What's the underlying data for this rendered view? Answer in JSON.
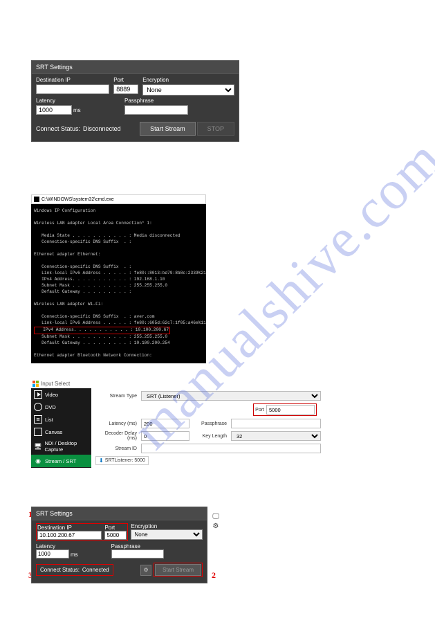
{
  "panel1": {
    "title": "SRT Settings",
    "dest_ip_label": "Destination IP",
    "dest_ip_value": "",
    "port_label": "Port",
    "port_value": "8889",
    "encryption_label": "Encryption",
    "encryption_value": "None",
    "latency_label": "Latency",
    "latency_value": "1000",
    "latency_unit": "ms",
    "passphrase_label": "Passphrase",
    "passphrase_value": "",
    "status_label": "Connect Status:",
    "status_value": "Disconnected",
    "start_btn": "Start Stream",
    "stop_btn": "STOP"
  },
  "panel2": {
    "title": "C:\\WINDOWS\\system32\\cmd.exe",
    "lines": [
      "Windows IP Configuration",
      "",
      "Wireless LAN adapter Local Area Connection* 1:",
      "",
      "   Media State . . . . . . . . . . . : Media disconnected",
      "   Connection-specific DNS Suffix  . :",
      "",
      "Ethernet adapter Ethernet:",
      "",
      "   Connection-specific DNS Suffix  . :",
      "   Link-local IPv6 Address . . . . . : fe80::8013:bd79:8b8c:2339%21",
      "   IPv4 Address. . . . . . . . . . . : 192.168.1.10",
      "   Subnet Mask . . . . . . . . . . . : 255.255.255.0",
      "   Default Gateway . . . . . . . . . :",
      "",
      "Wireless LAN adapter Wi-Fi:",
      "",
      "   Connection-specific DNS Suffix  . : aver.com",
      "   Link-local IPv6 Address . . . . . : fe80::605d:62c7:1f05:a46e%11"
    ],
    "highlight_line": "   IPv4 Address. . . . . . . . . . . : 10.100.200.67",
    "lines_after": [
      "   Subnet Mask . . . . . . . . . . . : 255.255.255.0",
      "   Default Gateway . . . . . . . . . : 10.100.200.254",
      "",
      "Ethernet adapter Bluetooth Network Connection:"
    ]
  },
  "panel3": {
    "title": "Input Select",
    "sidebar": {
      "items": [
        {
          "label": "Video"
        },
        {
          "label": "DVD"
        },
        {
          "label": "List"
        },
        {
          "label": "Canvas"
        },
        {
          "label": "NDI / Desktop Capture"
        },
        {
          "label": "Stream / SRT"
        }
      ]
    },
    "form": {
      "stream_type_label": "Stream Type",
      "stream_type_value": "SRT (Listener)",
      "port_label": "Port",
      "port_value": "5000",
      "latency_label": "Latency (ms)",
      "latency_value": "200",
      "passphrase_label": "Passphrase",
      "passphrase_value": "",
      "decoder_delay_label": "Decoder Delay (ms)",
      "decoder_delay_value": "0",
      "key_length_label": "Key Length",
      "key_length_value": "32",
      "stream_id_label": "Stream ID",
      "stream_id_value": "",
      "tab_label": "SRTListener: 5000"
    }
  },
  "panel4": {
    "title": "SRT Settings",
    "dest_ip_label": "Destination IP",
    "dest_ip_value": "10.100.200.67",
    "port_label": "Port",
    "port_value": "5000",
    "encryption_label": "Encryption",
    "encryption_value": "None",
    "latency_label": "Latency",
    "latency_value": "1000",
    "latency_unit": "ms",
    "passphrase_label": "Passphrase",
    "passphrase_value": "",
    "status_label": "Connect Status:",
    "status_value": "Connected",
    "start_btn": "Start Stream",
    "num1": "1",
    "num2": "2",
    "num3": "3"
  },
  "watermark": "manualshive.com"
}
